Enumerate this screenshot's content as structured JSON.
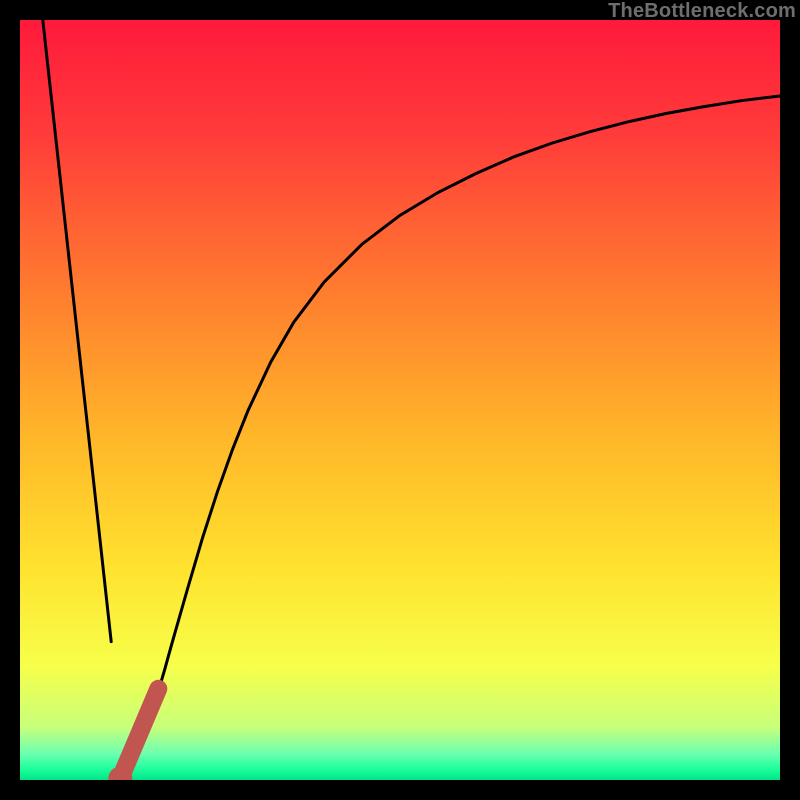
{
  "attribution": "TheBottleneck.com",
  "colors": {
    "frame": "#000000",
    "curve": "#000000",
    "marker": "#c1554f",
    "gradient_stops": [
      {
        "offset": 0.0,
        "color": "#ff1a3b"
      },
      {
        "offset": 0.15,
        "color": "#ff3b3a"
      },
      {
        "offset": 0.35,
        "color": "#ff7a2f"
      },
      {
        "offset": 0.55,
        "color": "#ffb729"
      },
      {
        "offset": 0.72,
        "color": "#ffe22e"
      },
      {
        "offset": 0.85,
        "color": "#f7ff4a"
      },
      {
        "offset": 0.93,
        "color": "#c8ff7a"
      },
      {
        "offset": 0.965,
        "color": "#6dffb0"
      },
      {
        "offset": 0.985,
        "color": "#1fff9c"
      },
      {
        "offset": 1.0,
        "color": "#00e58a"
      }
    ]
  },
  "chart_data": {
    "type": "line",
    "xlabel": "",
    "ylabel": "",
    "xlim": [
      0,
      100
    ],
    "ylim": [
      0,
      100
    ],
    "title": "",
    "series": [
      {
        "name": "left-branch",
        "x": [
          3.0,
          4.0,
          5.0,
          6.0,
          7.0,
          8.0,
          9.0,
          10.0,
          11.0,
          12.0
        ],
        "y": [
          100,
          90.9,
          81.8,
          72.7,
          63.6,
          54.5,
          45.5,
          36.4,
          27.3,
          18.2
        ]
      },
      {
        "name": "right-branch",
        "x": [
          13,
          14,
          15,
          16,
          17,
          18,
          19,
          20,
          22,
          24,
          26,
          28,
          30,
          33,
          36,
          40,
          45,
          50,
          55,
          60,
          65,
          70,
          75,
          80,
          85,
          90,
          95,
          100
        ],
        "y": [
          0.0,
          1.6,
          3.3,
          5.5,
          8.0,
          11.0,
          14.4,
          18.0,
          25.0,
          31.8,
          38.0,
          43.6,
          48.6,
          55.0,
          60.2,
          65.5,
          70.5,
          74.3,
          77.3,
          79.8,
          82.0,
          83.8,
          85.3,
          86.6,
          87.7,
          88.6,
          89.4,
          90.0
        ]
      }
    ],
    "marker_segment": {
      "name": "highlight",
      "x1": 13.2,
      "y1": 0.2,
      "x2": 18.2,
      "y2": 12.0
    }
  }
}
